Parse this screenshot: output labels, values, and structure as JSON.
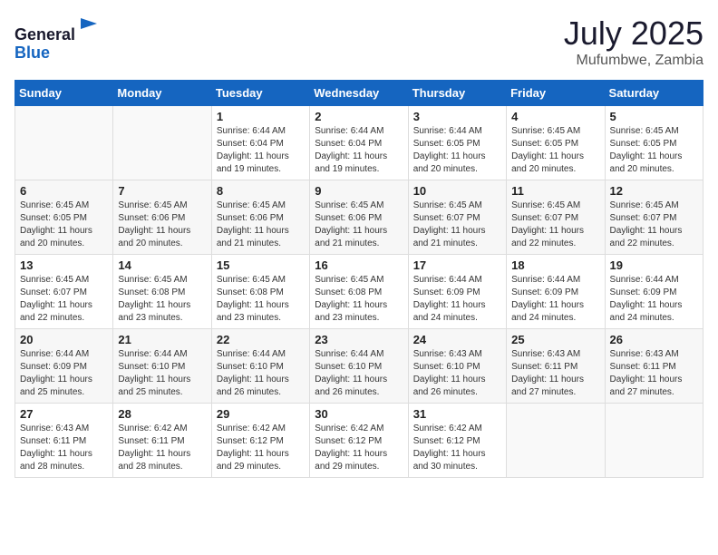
{
  "header": {
    "logo_general": "General",
    "logo_blue": "Blue",
    "month_year": "July 2025",
    "location": "Mufumbwe, Zambia"
  },
  "days_of_week": [
    "Sunday",
    "Monday",
    "Tuesday",
    "Wednesday",
    "Thursday",
    "Friday",
    "Saturday"
  ],
  "weeks": [
    [
      {
        "day": "",
        "info": ""
      },
      {
        "day": "",
        "info": ""
      },
      {
        "day": "1",
        "info": "Sunrise: 6:44 AM\nSunset: 6:04 PM\nDaylight: 11 hours and 19 minutes."
      },
      {
        "day": "2",
        "info": "Sunrise: 6:44 AM\nSunset: 6:04 PM\nDaylight: 11 hours and 19 minutes."
      },
      {
        "day": "3",
        "info": "Sunrise: 6:44 AM\nSunset: 6:05 PM\nDaylight: 11 hours and 20 minutes."
      },
      {
        "day": "4",
        "info": "Sunrise: 6:45 AM\nSunset: 6:05 PM\nDaylight: 11 hours and 20 minutes."
      },
      {
        "day": "5",
        "info": "Sunrise: 6:45 AM\nSunset: 6:05 PM\nDaylight: 11 hours and 20 minutes."
      }
    ],
    [
      {
        "day": "6",
        "info": "Sunrise: 6:45 AM\nSunset: 6:05 PM\nDaylight: 11 hours and 20 minutes."
      },
      {
        "day": "7",
        "info": "Sunrise: 6:45 AM\nSunset: 6:06 PM\nDaylight: 11 hours and 20 minutes."
      },
      {
        "day": "8",
        "info": "Sunrise: 6:45 AM\nSunset: 6:06 PM\nDaylight: 11 hours and 21 minutes."
      },
      {
        "day": "9",
        "info": "Sunrise: 6:45 AM\nSunset: 6:06 PM\nDaylight: 11 hours and 21 minutes."
      },
      {
        "day": "10",
        "info": "Sunrise: 6:45 AM\nSunset: 6:07 PM\nDaylight: 11 hours and 21 minutes."
      },
      {
        "day": "11",
        "info": "Sunrise: 6:45 AM\nSunset: 6:07 PM\nDaylight: 11 hours and 22 minutes."
      },
      {
        "day": "12",
        "info": "Sunrise: 6:45 AM\nSunset: 6:07 PM\nDaylight: 11 hours and 22 minutes."
      }
    ],
    [
      {
        "day": "13",
        "info": "Sunrise: 6:45 AM\nSunset: 6:07 PM\nDaylight: 11 hours and 22 minutes."
      },
      {
        "day": "14",
        "info": "Sunrise: 6:45 AM\nSunset: 6:08 PM\nDaylight: 11 hours and 23 minutes."
      },
      {
        "day": "15",
        "info": "Sunrise: 6:45 AM\nSunset: 6:08 PM\nDaylight: 11 hours and 23 minutes."
      },
      {
        "day": "16",
        "info": "Sunrise: 6:45 AM\nSunset: 6:08 PM\nDaylight: 11 hours and 23 minutes."
      },
      {
        "day": "17",
        "info": "Sunrise: 6:44 AM\nSunset: 6:09 PM\nDaylight: 11 hours and 24 minutes."
      },
      {
        "day": "18",
        "info": "Sunrise: 6:44 AM\nSunset: 6:09 PM\nDaylight: 11 hours and 24 minutes."
      },
      {
        "day": "19",
        "info": "Sunrise: 6:44 AM\nSunset: 6:09 PM\nDaylight: 11 hours and 24 minutes."
      }
    ],
    [
      {
        "day": "20",
        "info": "Sunrise: 6:44 AM\nSunset: 6:09 PM\nDaylight: 11 hours and 25 minutes."
      },
      {
        "day": "21",
        "info": "Sunrise: 6:44 AM\nSunset: 6:10 PM\nDaylight: 11 hours and 25 minutes."
      },
      {
        "day": "22",
        "info": "Sunrise: 6:44 AM\nSunset: 6:10 PM\nDaylight: 11 hours and 26 minutes."
      },
      {
        "day": "23",
        "info": "Sunrise: 6:44 AM\nSunset: 6:10 PM\nDaylight: 11 hours and 26 minutes."
      },
      {
        "day": "24",
        "info": "Sunrise: 6:43 AM\nSunset: 6:10 PM\nDaylight: 11 hours and 26 minutes."
      },
      {
        "day": "25",
        "info": "Sunrise: 6:43 AM\nSunset: 6:11 PM\nDaylight: 11 hours and 27 minutes."
      },
      {
        "day": "26",
        "info": "Sunrise: 6:43 AM\nSunset: 6:11 PM\nDaylight: 11 hours and 27 minutes."
      }
    ],
    [
      {
        "day": "27",
        "info": "Sunrise: 6:43 AM\nSunset: 6:11 PM\nDaylight: 11 hours and 28 minutes."
      },
      {
        "day": "28",
        "info": "Sunrise: 6:42 AM\nSunset: 6:11 PM\nDaylight: 11 hours and 28 minutes."
      },
      {
        "day": "29",
        "info": "Sunrise: 6:42 AM\nSunset: 6:12 PM\nDaylight: 11 hours and 29 minutes."
      },
      {
        "day": "30",
        "info": "Sunrise: 6:42 AM\nSunset: 6:12 PM\nDaylight: 11 hours and 29 minutes."
      },
      {
        "day": "31",
        "info": "Sunrise: 6:42 AM\nSunset: 6:12 PM\nDaylight: 11 hours and 30 minutes."
      },
      {
        "day": "",
        "info": ""
      },
      {
        "day": "",
        "info": ""
      }
    ]
  ]
}
